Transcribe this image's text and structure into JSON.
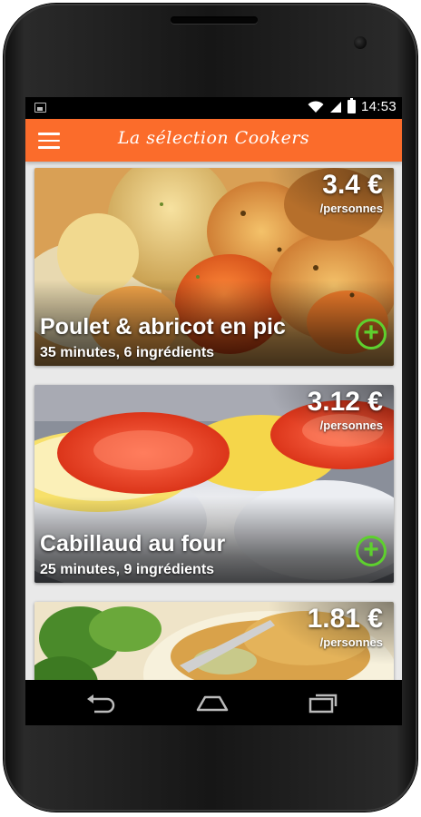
{
  "status_bar": {
    "time": "14:53",
    "icons": [
      "image-notification-icon",
      "wifi-icon",
      "signal-icon",
      "battery-icon"
    ]
  },
  "app_bar": {
    "title": "La sélection Cookers",
    "menu_icon": "hamburger-menu-icon",
    "color": "#fb6c2b"
  },
  "recipes": [
    {
      "price": "3.4 €",
      "per": "/personnes",
      "title": "Poulet & abricot en pic",
      "meta": "35 minutes, 6 ingrédients"
    },
    {
      "price": "3.12 €",
      "per": "/personnes",
      "title": "Cabillaud au four",
      "meta": "25 minutes, 9 ingrédients"
    },
    {
      "price": "1.81 €",
      "per": "/personnes",
      "title": "",
      "meta": ""
    }
  ],
  "add_icon": "plus-circle-icon",
  "accent_green": "#5ed02e",
  "nav_bar": {
    "buttons": [
      "back-icon",
      "home-icon",
      "recent-apps-icon"
    ]
  }
}
